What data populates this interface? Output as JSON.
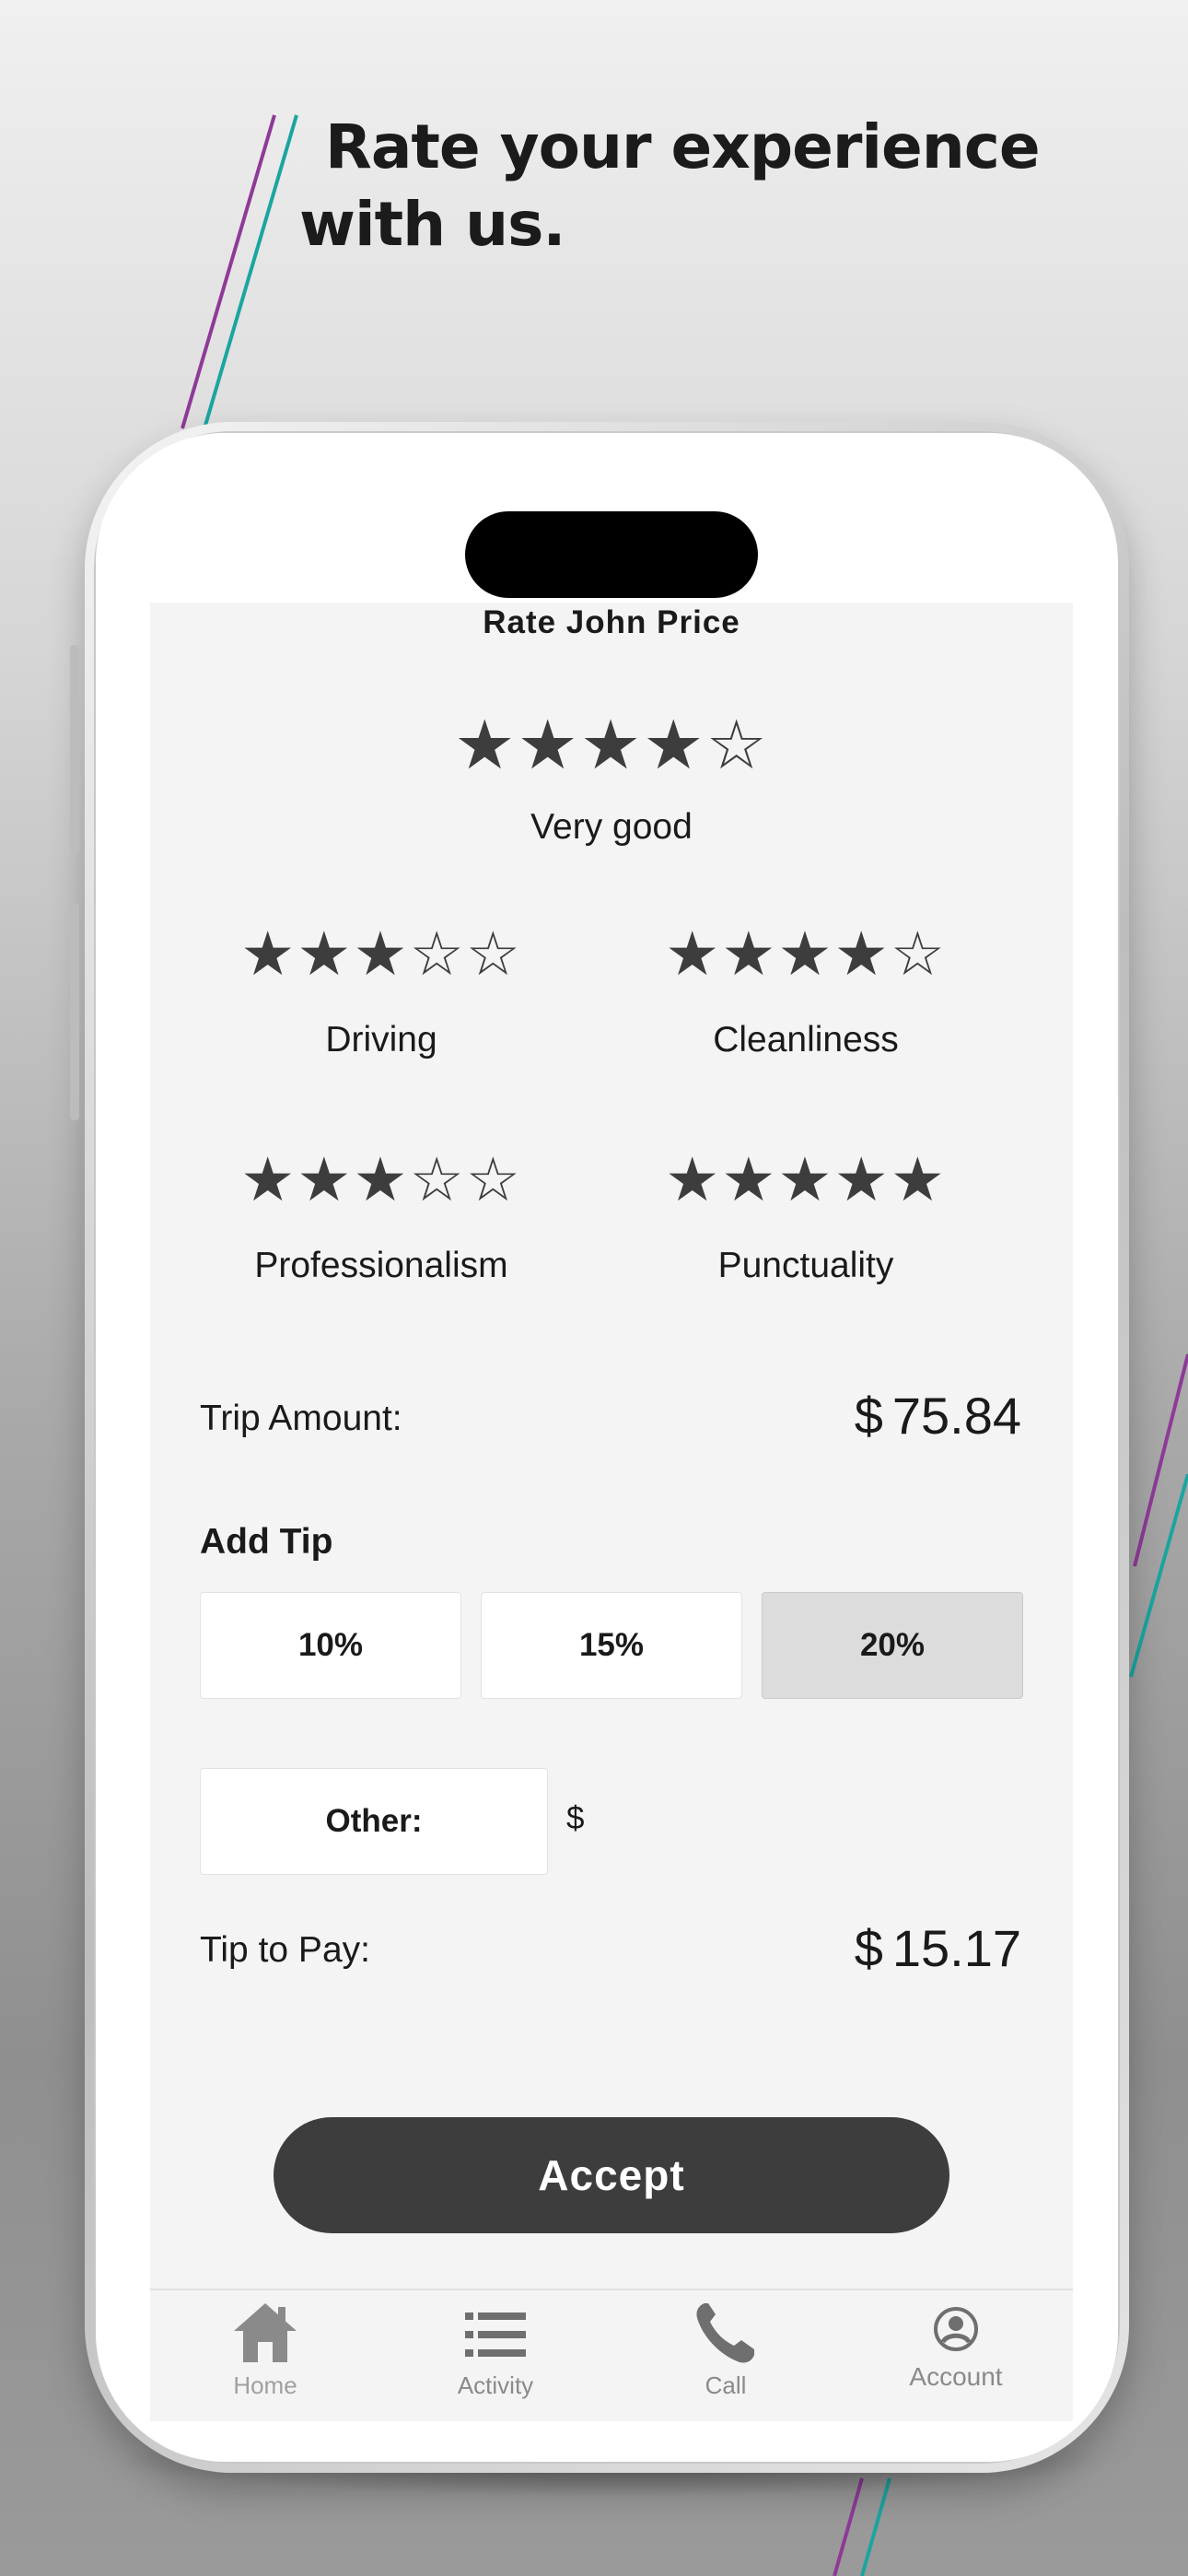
{
  "headline": {
    "line1": "Rate your experience",
    "line2": "with us."
  },
  "screen": {
    "title": "Rate John Price",
    "overall": {
      "stars": "★★★★☆",
      "rating": 4,
      "label": "Very good"
    },
    "categories": [
      {
        "label": "Driving",
        "stars": "★★★☆☆",
        "rating": 3
      },
      {
        "label": "Cleanliness",
        "stars": "★★★★☆",
        "rating": 4
      },
      {
        "label": "Professionalism",
        "stars": "★★★☆☆",
        "rating": 3
      },
      {
        "label": "Punctuality",
        "stars": "★★★★★",
        "rating": 5
      }
    ],
    "trip": {
      "label": "Trip Amount:",
      "currency": "$",
      "amount": "75.84"
    },
    "tip": {
      "heading": "Add Tip",
      "options": [
        "10%",
        "15%",
        "20%"
      ],
      "selected": "20%",
      "other_label": "Other:",
      "other_currency": "$"
    },
    "tip_to_pay": {
      "label": "Tip to Pay:",
      "currency": "$",
      "amount": "15.17"
    },
    "accept_label": "Accept"
  },
  "tabbar": {
    "items": [
      {
        "label": "Home",
        "icon": "home-icon"
      },
      {
        "label": "Activity",
        "icon": "list-icon"
      },
      {
        "label": "Call",
        "icon": "phone-icon"
      },
      {
        "label": "Account",
        "icon": "user-circle-icon"
      }
    ]
  },
  "colors": {
    "accent_dark": "#3d3d3d",
    "screen_bg": "#f4f4f4",
    "line_purple": "#8e3a98",
    "line_teal": "#1aa5a0"
  }
}
